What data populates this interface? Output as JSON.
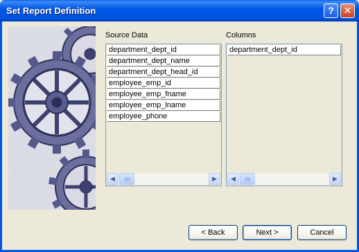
{
  "window": {
    "title": "Set Report Definition"
  },
  "title_buttons": {
    "help": "?",
    "close": "✕"
  },
  "source": {
    "label": "Source Data",
    "items": [
      "department_dept_id",
      "department_dept_name",
      "department_dept_head_id",
      "employee_emp_id",
      "employee_emp_fname",
      "employee_emp_lname",
      "employee_phone"
    ]
  },
  "columns": {
    "label": "Columns",
    "items": [
      "department_dept_id"
    ]
  },
  "scroll": {
    "left": "◀",
    "right": "▶"
  },
  "buttons": {
    "back": "< Back",
    "next": "Next >",
    "cancel": "Cancel"
  }
}
